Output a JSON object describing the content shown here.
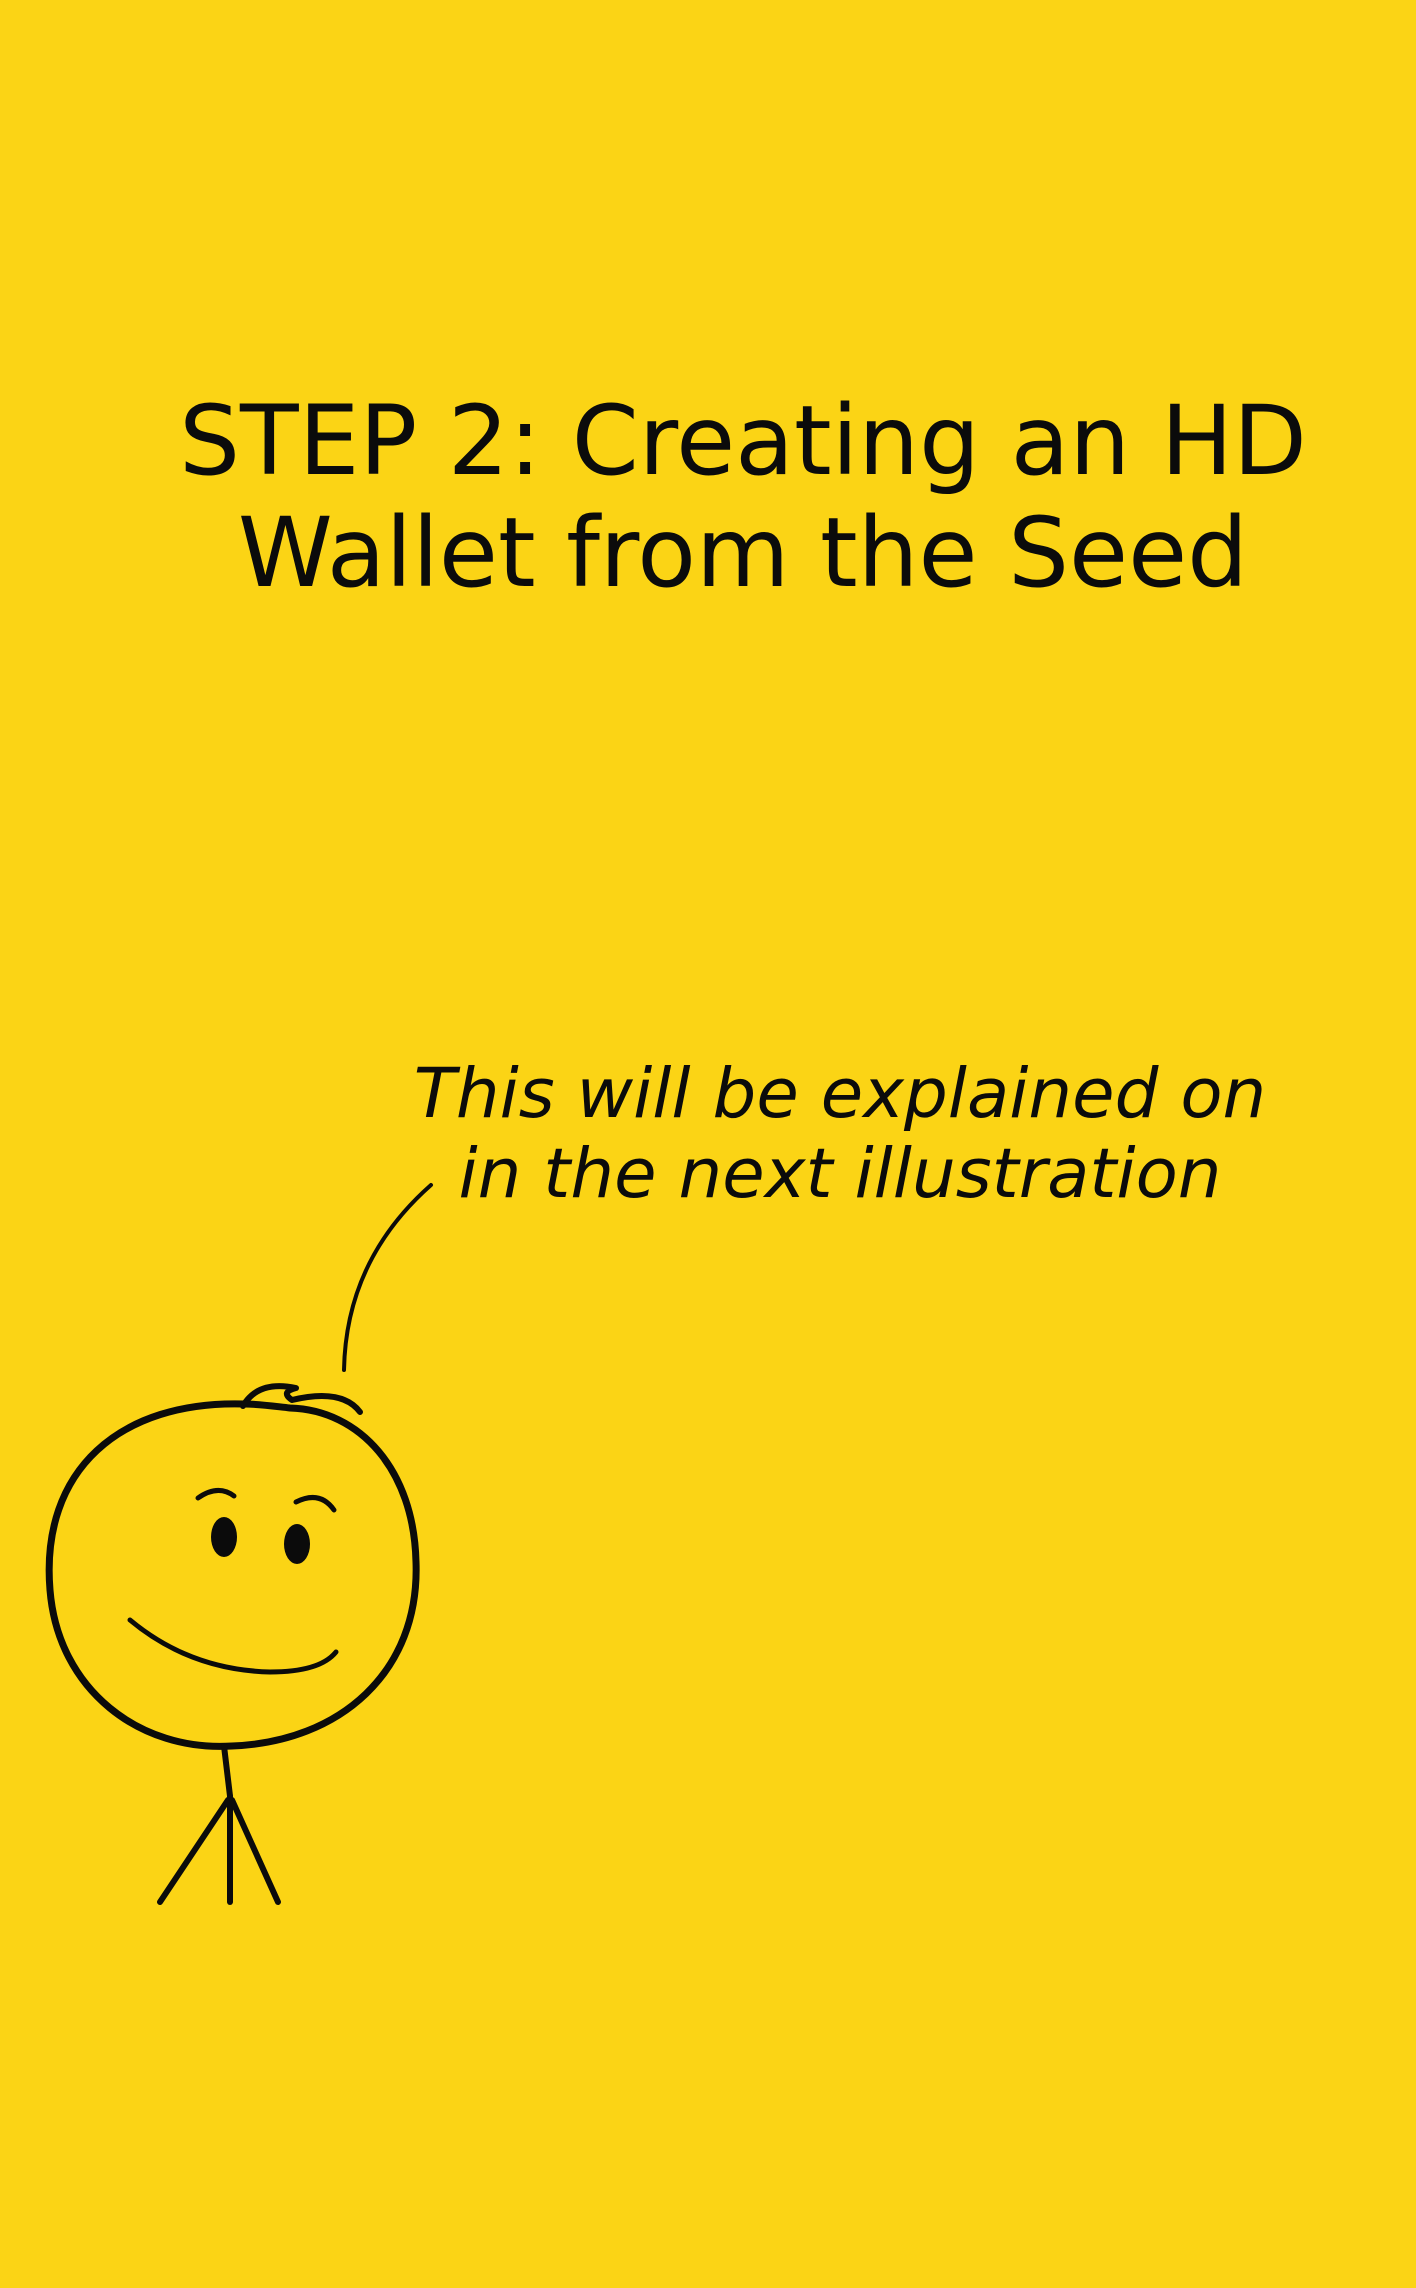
{
  "colors": {
    "background": "#fbd415",
    "ink": "#0b0b0b"
  },
  "title": {
    "line1": "STEP 2: Creating an HD",
    "line2": "Wallet from the Seed"
  },
  "speech": {
    "line1": "This will be explained on",
    "line2": "in the next illustration"
  },
  "icons": {
    "character": "stick-figure-smiling",
    "speech_pointer": "curved-speech-line"
  }
}
